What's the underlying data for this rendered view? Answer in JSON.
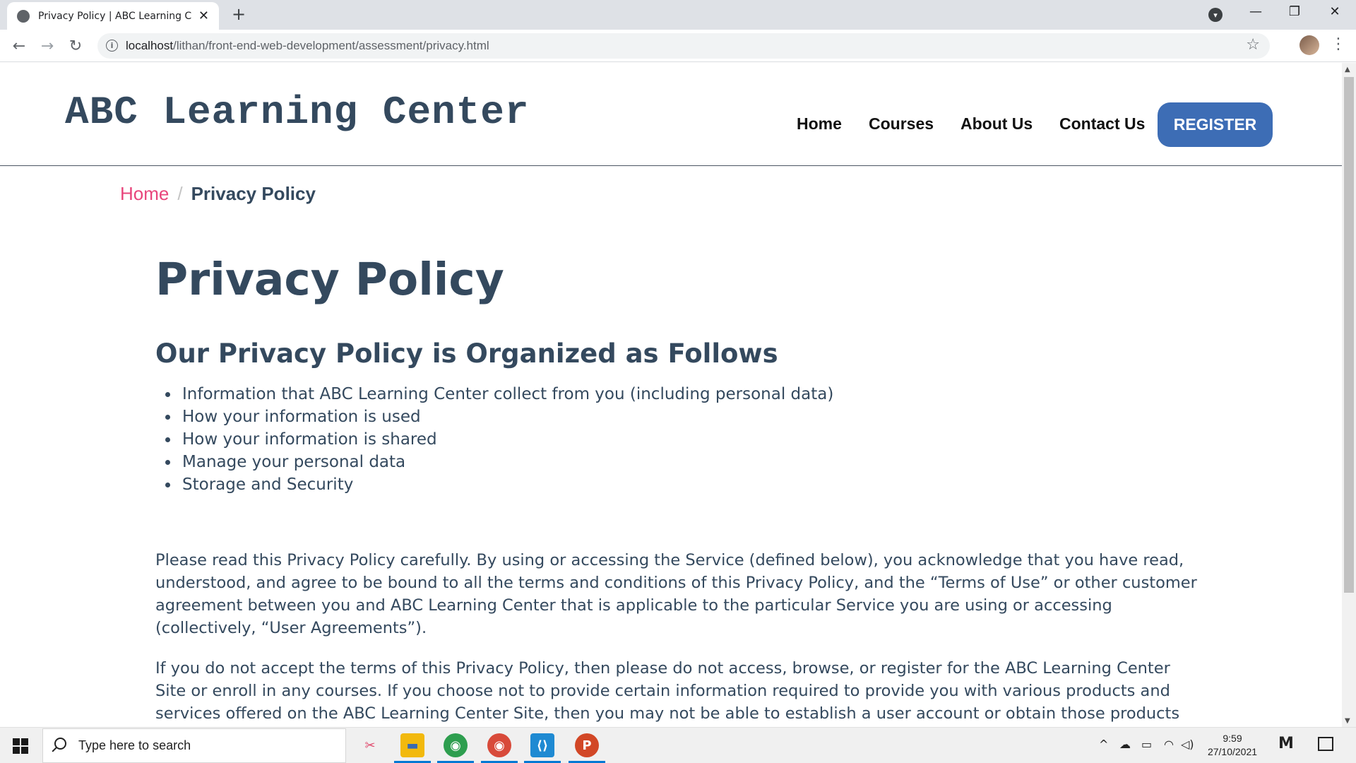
{
  "browser": {
    "tab_title": "Privacy Policy | ABC Learning Center",
    "tab_close": "✕",
    "new_tab": "+",
    "url_host": "localhost",
    "url_path": "/lithan/front-end-web-development/assessment/privacy.html",
    "info_glyph": "i",
    "back_glyph": "←",
    "forward_glyph": "→",
    "reload_glyph": "↻",
    "star_glyph": "☆",
    "kebab_glyph": "⋮",
    "profile_glyph": "▾",
    "minimize_glyph": "—",
    "maximize_glyph": "❐",
    "close_glyph": "✕"
  },
  "site": {
    "brand": "ABC Learning Center",
    "nav": [
      "Home",
      "Courses",
      "About Us",
      "Contact Us"
    ],
    "register_label": "REGISTER",
    "accent_color": "#3d6db5",
    "text_color": "#34495e",
    "link_color": "#e8467c"
  },
  "breadcrumb": {
    "home": "Home",
    "separator": "/",
    "current": "Privacy Policy"
  },
  "content": {
    "title": "Privacy Policy",
    "subtitle": "Our Privacy Policy is Organized as Follows",
    "toc": [
      "Information that ABC Learning Center collect from you (including personal data)",
      "How your information is used",
      "How your information is shared",
      "Manage your personal data",
      "Storage and Security"
    ],
    "paragraph_1": "Please read this Privacy Policy carefully. By using or accessing the Service (defined below), you acknowledge that you have read, understood, and agree to be bound to all the terms and conditions of this Privacy Policy, and the “Terms of Use” or other customer agreement between you and ABC Learning Center that is applicable to the particular Service you are using or accessing (collectively, “User Agreements”).",
    "paragraph_2": "If you do not accept the terms of this Privacy Policy, then please do not access, browse, or register for the ABC Learning Center Site or enroll in any courses. If you choose not to provide certain information required to provide you with various products and services offered on the ABC Learning Center Site, then you may not be able to establish a user account or obtain those products or services."
  },
  "taskbar": {
    "search_placeholder": "Type here to search",
    "apps": [
      {
        "name": "snipping-tool",
        "glyph": "✂",
        "color": "#e04a6d"
      },
      {
        "name": "file-explorer",
        "glyph": "▬",
        "color": "#f2b90d"
      },
      {
        "name": "chrome",
        "glyph": "◉",
        "color": "#2e9e4f"
      },
      {
        "name": "chrome-profile",
        "glyph": "◉",
        "color": "#d84a3a"
      },
      {
        "name": "vscode",
        "glyph": "⟨⟩",
        "color": "#1f8ad2"
      },
      {
        "name": "powerpoint",
        "glyph": "P",
        "color": "#d24726"
      }
    ],
    "time": "9:59",
    "date": "27/10/2021",
    "tray_chevron": "^",
    "tray_cloud": "☁",
    "tray_battery": "▭",
    "tray_wifi": "◠",
    "tray_volume": "◁)",
    "tray_mail": "M"
  }
}
